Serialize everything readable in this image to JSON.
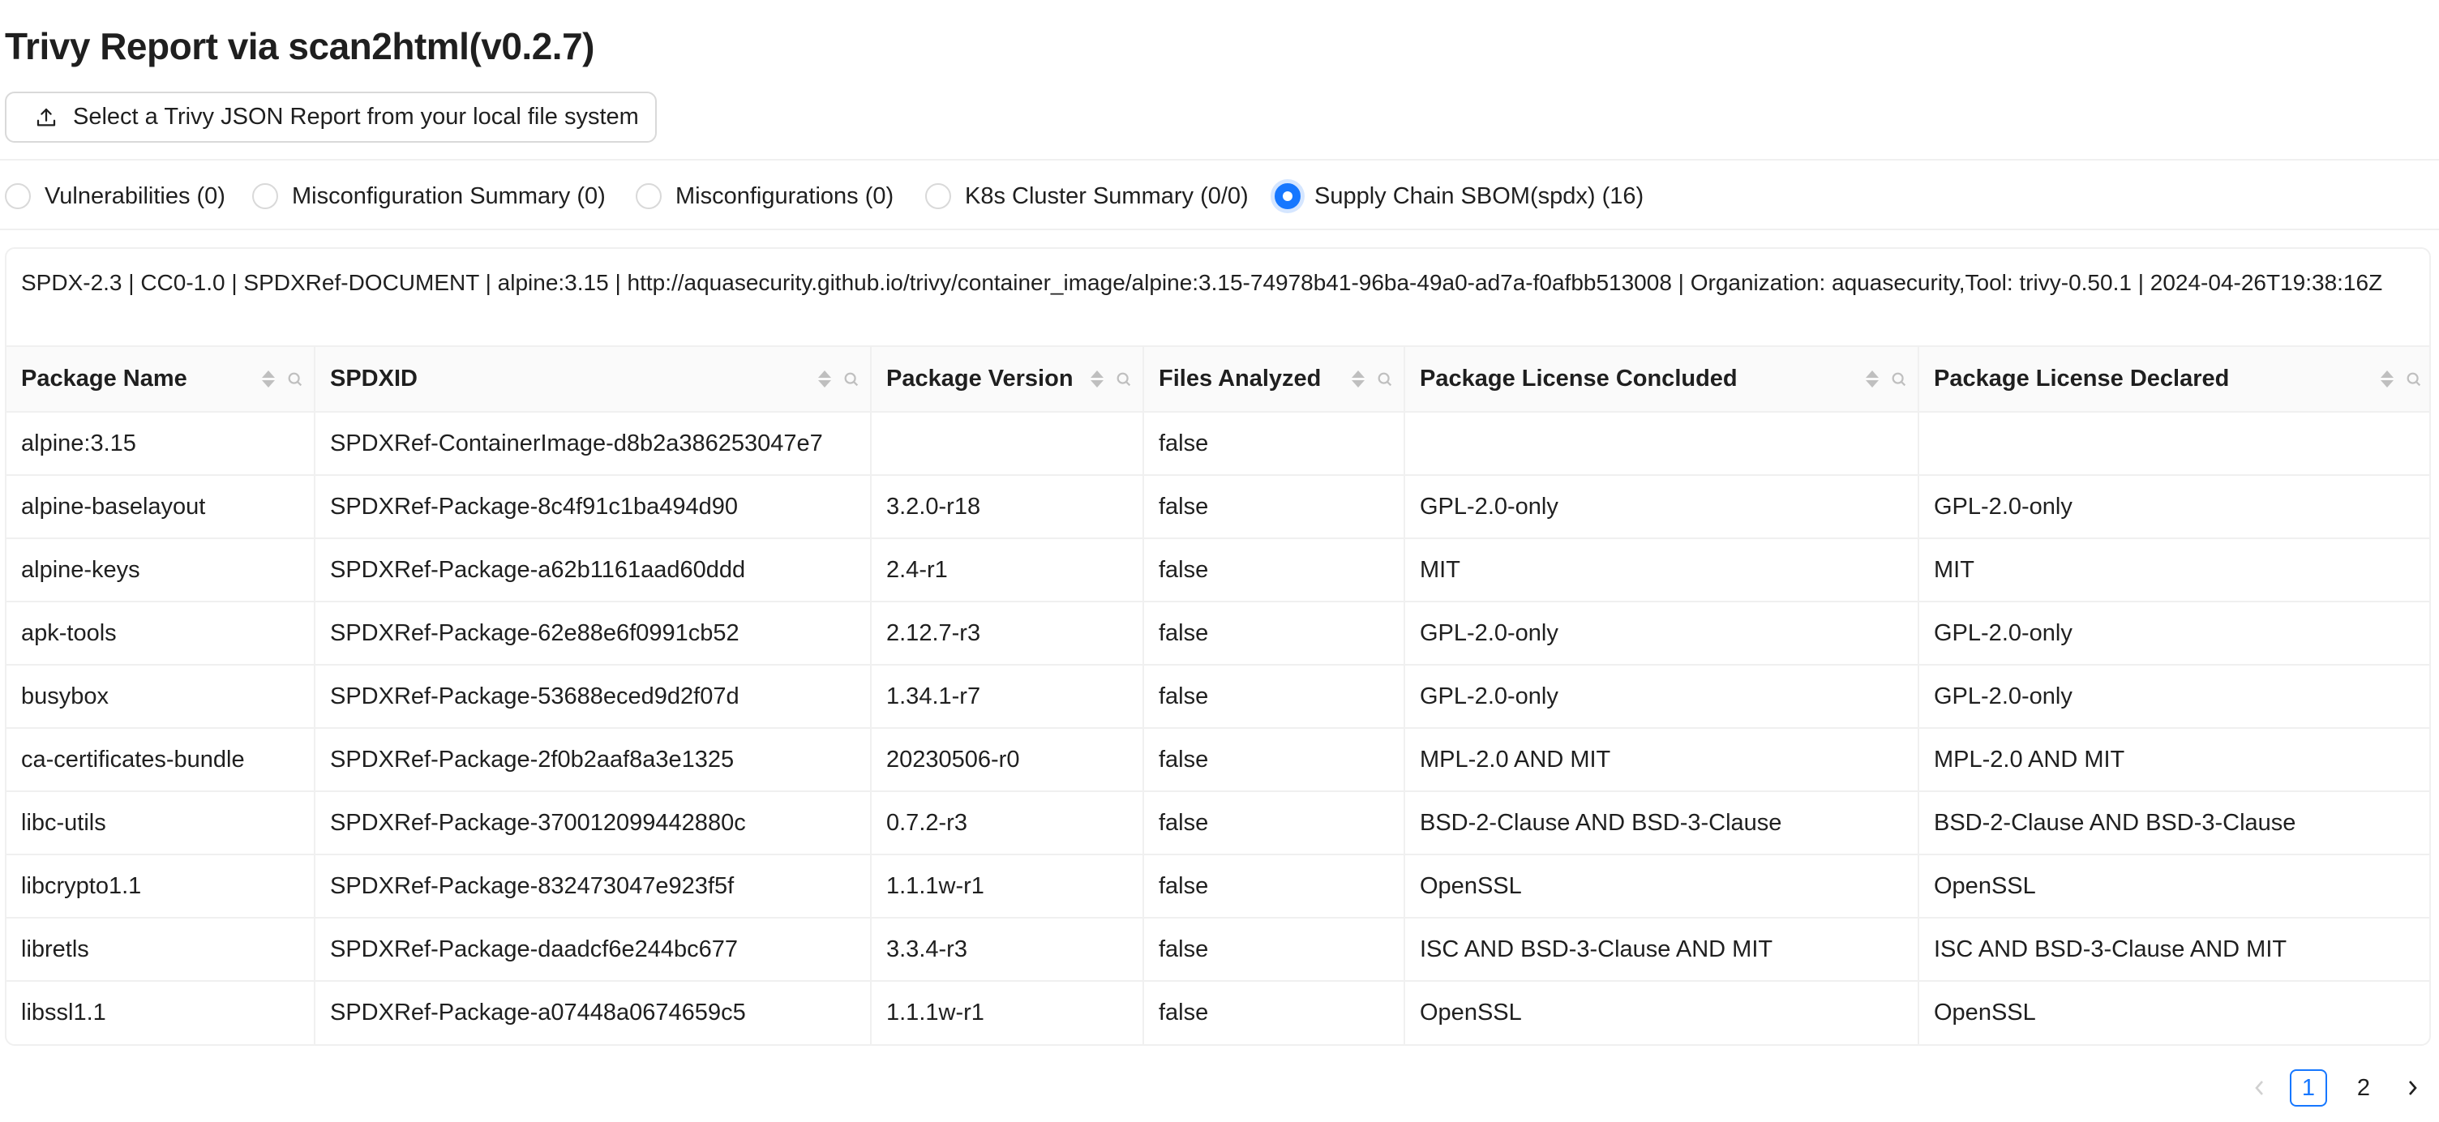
{
  "page": {
    "title": "Trivy Report via scan2html(v0.2.7)"
  },
  "upload": {
    "label": "Select a Trivy JSON Report from your local file system",
    "icon": "upload-icon"
  },
  "tabs": [
    {
      "label": "Vulnerabilities (0)",
      "checked": false
    },
    {
      "label": "Misconfiguration Summary (0)",
      "checked": false
    },
    {
      "label": "Misconfigurations (0)",
      "checked": false
    },
    {
      "label": "K8s Cluster Summary (0/0)",
      "checked": false
    },
    {
      "label": "Supply Chain SBOM(spdx) (16)",
      "checked": true
    }
  ],
  "sbom": {
    "document_info": "SPDX-2.3 | CC0-1.0 | SPDXRef-DOCUMENT | alpine:3.15 | http://aquasecurity.github.io/trivy/container_image/alpine:3.15-74978b41-96ba-49a0-ad7a-f0afbb513008 | Organization: aquasecurity,Tool: trivy-0.50.1 | 2024-04-26T19:38:16Z",
    "columns": [
      "Package Name",
      "SPDXID",
      "Package Version",
      "Files Analyzed",
      "Package License Concluded",
      "Package License Declared"
    ],
    "rows": [
      [
        "alpine:3.15",
        "SPDXRef-ContainerImage-d8b2a386253047e7",
        "",
        "false",
        "",
        ""
      ],
      [
        "alpine-baselayout",
        "SPDXRef-Package-8c4f91c1ba494d90",
        "3.2.0-r18",
        "false",
        "GPL-2.0-only",
        "GPL-2.0-only"
      ],
      [
        "alpine-keys",
        "SPDXRef-Package-a62b1161aad60ddd",
        "2.4-r1",
        "false",
        "MIT",
        "MIT"
      ],
      [
        "apk-tools",
        "SPDXRef-Package-62e88e6f0991cb52",
        "2.12.7-r3",
        "false",
        "GPL-2.0-only",
        "GPL-2.0-only"
      ],
      [
        "busybox",
        "SPDXRef-Package-53688eced9d2f07d",
        "1.34.1-r7",
        "false",
        "GPL-2.0-only",
        "GPL-2.0-only"
      ],
      [
        "ca-certificates-bundle",
        "SPDXRef-Package-2f0b2aaf8a3e1325",
        "20230506-r0",
        "false",
        "MPL-2.0 AND MIT",
        "MPL-2.0 AND MIT"
      ],
      [
        "libc-utils",
        "SPDXRef-Package-370012099442880c",
        "0.7.2-r3",
        "false",
        "BSD-2-Clause AND BSD-3-Clause",
        "BSD-2-Clause AND BSD-3-Clause"
      ],
      [
        "libcrypto1.1",
        "SPDXRef-Package-832473047e923f5f",
        "1.1.1w-r1",
        "false",
        "OpenSSL",
        "OpenSSL"
      ],
      [
        "libretls",
        "SPDXRef-Package-daadcf6e244bc677",
        "3.3.4-r3",
        "false",
        "ISC AND BSD-3-Clause AND MIT",
        "ISC AND BSD-3-Clause AND MIT"
      ],
      [
        "libssl1.1",
        "SPDXRef-Package-a07448a0674659c5",
        "1.1.1w-r1",
        "false",
        "OpenSSL",
        "OpenSSL"
      ]
    ]
  },
  "pagination": {
    "pages": [
      "1",
      "2"
    ],
    "current": "1"
  },
  "colors": {
    "accent": "#1677ff",
    "border": "#f0f0f0",
    "header_bg": "#fafafa"
  }
}
